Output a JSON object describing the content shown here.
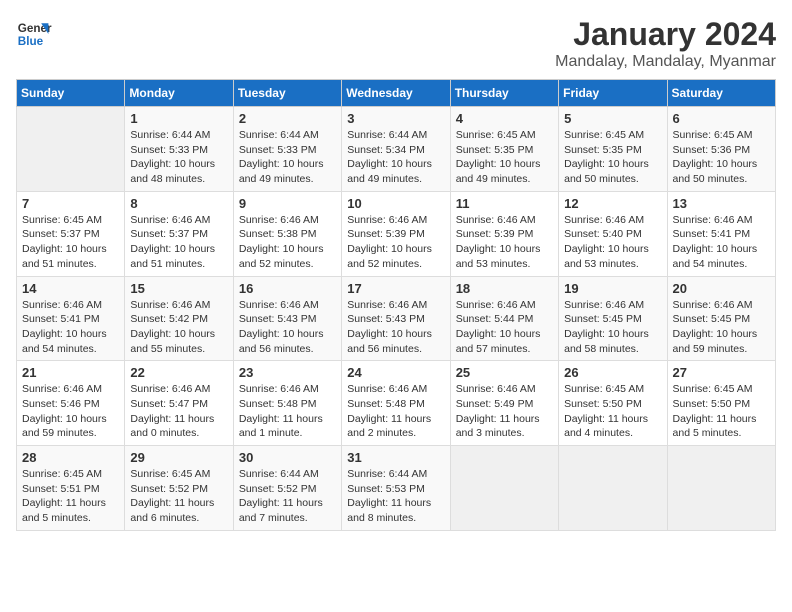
{
  "logo": {
    "line1": "General",
    "line2": "Blue"
  },
  "title": "January 2024",
  "subtitle": "Mandalay, Mandalay, Myanmar",
  "days_header": [
    "Sunday",
    "Monday",
    "Tuesday",
    "Wednesday",
    "Thursday",
    "Friday",
    "Saturday"
  ],
  "weeks": [
    [
      {
        "day": "",
        "info": ""
      },
      {
        "day": "1",
        "info": "Sunrise: 6:44 AM\nSunset: 5:33 PM\nDaylight: 10 hours\nand 48 minutes."
      },
      {
        "day": "2",
        "info": "Sunrise: 6:44 AM\nSunset: 5:33 PM\nDaylight: 10 hours\nand 49 minutes."
      },
      {
        "day": "3",
        "info": "Sunrise: 6:44 AM\nSunset: 5:34 PM\nDaylight: 10 hours\nand 49 minutes."
      },
      {
        "day": "4",
        "info": "Sunrise: 6:45 AM\nSunset: 5:35 PM\nDaylight: 10 hours\nand 49 minutes."
      },
      {
        "day": "5",
        "info": "Sunrise: 6:45 AM\nSunset: 5:35 PM\nDaylight: 10 hours\nand 50 minutes."
      },
      {
        "day": "6",
        "info": "Sunrise: 6:45 AM\nSunset: 5:36 PM\nDaylight: 10 hours\nand 50 minutes."
      }
    ],
    [
      {
        "day": "7",
        "info": "Sunrise: 6:45 AM\nSunset: 5:37 PM\nDaylight: 10 hours\nand 51 minutes."
      },
      {
        "day": "8",
        "info": "Sunrise: 6:46 AM\nSunset: 5:37 PM\nDaylight: 10 hours\nand 51 minutes."
      },
      {
        "day": "9",
        "info": "Sunrise: 6:46 AM\nSunset: 5:38 PM\nDaylight: 10 hours\nand 52 minutes."
      },
      {
        "day": "10",
        "info": "Sunrise: 6:46 AM\nSunset: 5:39 PM\nDaylight: 10 hours\nand 52 minutes."
      },
      {
        "day": "11",
        "info": "Sunrise: 6:46 AM\nSunset: 5:39 PM\nDaylight: 10 hours\nand 53 minutes."
      },
      {
        "day": "12",
        "info": "Sunrise: 6:46 AM\nSunset: 5:40 PM\nDaylight: 10 hours\nand 53 minutes."
      },
      {
        "day": "13",
        "info": "Sunrise: 6:46 AM\nSunset: 5:41 PM\nDaylight: 10 hours\nand 54 minutes."
      }
    ],
    [
      {
        "day": "14",
        "info": "Sunrise: 6:46 AM\nSunset: 5:41 PM\nDaylight: 10 hours\nand 54 minutes."
      },
      {
        "day": "15",
        "info": "Sunrise: 6:46 AM\nSunset: 5:42 PM\nDaylight: 10 hours\nand 55 minutes."
      },
      {
        "day": "16",
        "info": "Sunrise: 6:46 AM\nSunset: 5:43 PM\nDaylight: 10 hours\nand 56 minutes."
      },
      {
        "day": "17",
        "info": "Sunrise: 6:46 AM\nSunset: 5:43 PM\nDaylight: 10 hours\nand 56 minutes."
      },
      {
        "day": "18",
        "info": "Sunrise: 6:46 AM\nSunset: 5:44 PM\nDaylight: 10 hours\nand 57 minutes."
      },
      {
        "day": "19",
        "info": "Sunrise: 6:46 AM\nSunset: 5:45 PM\nDaylight: 10 hours\nand 58 minutes."
      },
      {
        "day": "20",
        "info": "Sunrise: 6:46 AM\nSunset: 5:45 PM\nDaylight: 10 hours\nand 59 minutes."
      }
    ],
    [
      {
        "day": "21",
        "info": "Sunrise: 6:46 AM\nSunset: 5:46 PM\nDaylight: 10 hours\nand 59 minutes."
      },
      {
        "day": "22",
        "info": "Sunrise: 6:46 AM\nSunset: 5:47 PM\nDaylight: 11 hours\nand 0 minutes."
      },
      {
        "day": "23",
        "info": "Sunrise: 6:46 AM\nSunset: 5:48 PM\nDaylight: 11 hours\nand 1 minute."
      },
      {
        "day": "24",
        "info": "Sunrise: 6:46 AM\nSunset: 5:48 PM\nDaylight: 11 hours\nand 2 minutes."
      },
      {
        "day": "25",
        "info": "Sunrise: 6:46 AM\nSunset: 5:49 PM\nDaylight: 11 hours\nand 3 minutes."
      },
      {
        "day": "26",
        "info": "Sunrise: 6:45 AM\nSunset: 5:50 PM\nDaylight: 11 hours\nand 4 minutes."
      },
      {
        "day": "27",
        "info": "Sunrise: 6:45 AM\nSunset: 5:50 PM\nDaylight: 11 hours\nand 5 minutes."
      }
    ],
    [
      {
        "day": "28",
        "info": "Sunrise: 6:45 AM\nSunset: 5:51 PM\nDaylight: 11 hours\nand 5 minutes."
      },
      {
        "day": "29",
        "info": "Sunrise: 6:45 AM\nSunset: 5:52 PM\nDaylight: 11 hours\nand 6 minutes."
      },
      {
        "day": "30",
        "info": "Sunrise: 6:44 AM\nSunset: 5:52 PM\nDaylight: 11 hours\nand 7 minutes."
      },
      {
        "day": "31",
        "info": "Sunrise: 6:44 AM\nSunset: 5:53 PM\nDaylight: 11 hours\nand 8 minutes."
      },
      {
        "day": "",
        "info": ""
      },
      {
        "day": "",
        "info": ""
      },
      {
        "day": "",
        "info": ""
      }
    ]
  ]
}
